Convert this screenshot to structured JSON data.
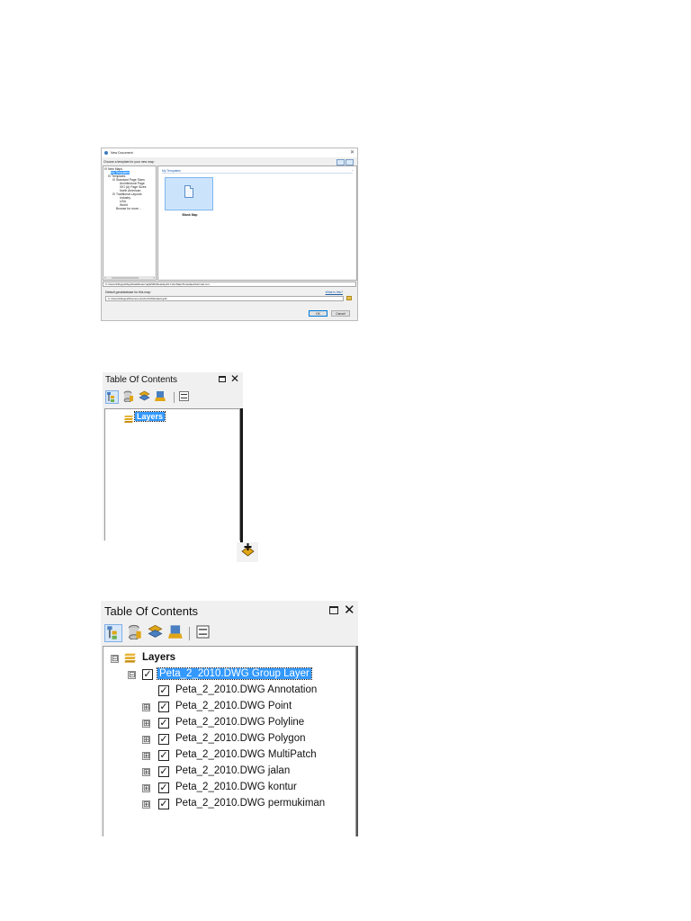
{
  "new_document": {
    "title": "New Document",
    "close_glyph": "✕",
    "prompt": "Choose a template for your new map:",
    "tree": [
      "New Maps",
      "My Templates",
      "Templates",
      "Standard Page Sizes",
      "Architectural Page",
      "ISO (A) Page Sizes",
      "North American",
      "Traditional Layouts",
      "Industry",
      "USA",
      "World",
      "Browse for more..."
    ],
    "tree_expanders": [
      "⊟",
      "⊟",
      "⊟",
      "⊟"
    ],
    "content_header": "My Templates",
    "content_caret": "⌄",
    "tile_label": "Blank Map",
    "template_path": "C:\\Users\\Nilograf\\AppData\\Roaming\\ESRI\\Desktop10.1\\ArcMap\\Templates\\Normal.mxt",
    "gdb_label": "Default geodatabase for this map:",
    "gdb_link": "What is this?",
    "gdb_path": "C:\\Users\\Nilograf\\Documents\\ArcGIS\\Default.gdb",
    "ok_label": "OK",
    "cancel_label": "Cancel",
    "scroll_left": "‹",
    "scroll_right": "›"
  },
  "toc_small": {
    "title": "Table Of Contents",
    "close_glyph": "✕",
    "root_layer": "Layers"
  },
  "toc_large": {
    "title": "Table Of Contents",
    "close_glyph": "✕",
    "root_layer": "Layers",
    "group_layer": "Peta_2_2010.DWG Group Layer",
    "sublayers": [
      {
        "name": "Peta_2_2010.DWG Annotation",
        "expandable": false
      },
      {
        "name": "Peta_2_2010.DWG Point",
        "expandable": true
      },
      {
        "name": "Peta_2_2010.DWG Polyline",
        "expandable": true
      },
      {
        "name": "Peta_2_2010.DWG Polygon",
        "expandable": true
      },
      {
        "name": "Peta_2_2010.DWG MultiPatch",
        "expandable": true
      },
      {
        "name": "Peta_2_2010.DWG jalan",
        "expandable": true
      },
      {
        "name": "Peta_2_2010.DWG kontur",
        "expandable": true
      },
      {
        "name": "Peta_2_2010.DWG permukiman",
        "expandable": true
      }
    ]
  },
  "toolbar_icons": [
    "list-by-drawing-order-icon",
    "list-by-source-icon",
    "list-by-visibility-icon",
    "list-by-selection-icon",
    "options-icon"
  ],
  "glyphs": {
    "collapse": "⊟",
    "expand": "⊞",
    "check": "✓",
    "drag": "✥"
  },
  "colors": {
    "selection": "#3399ff",
    "layer_icon": "#e0a616"
  }
}
